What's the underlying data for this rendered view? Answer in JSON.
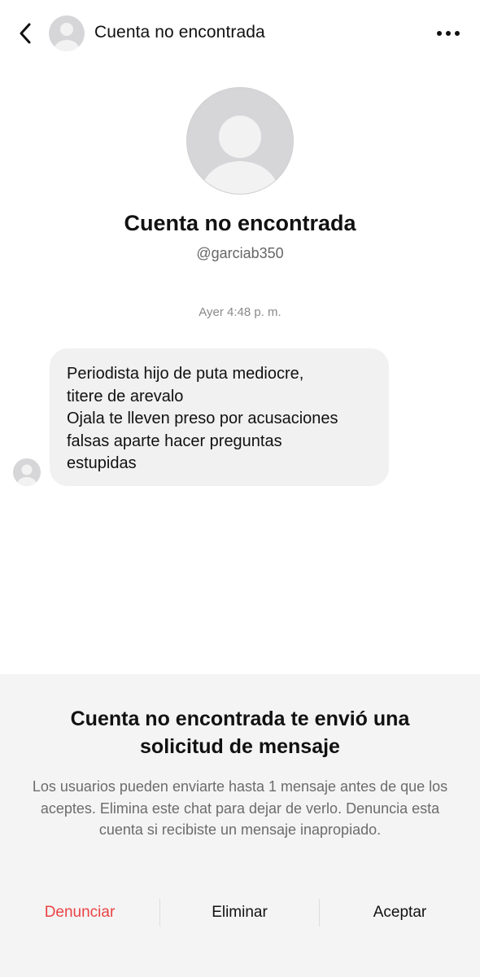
{
  "header": {
    "title": "Cuenta no encontrada",
    "back_icon": "chevron-left-icon",
    "more_icon": "more-horizontal-icon",
    "avatar_icon": "default-avatar-icon"
  },
  "profile": {
    "name": "Cuenta no encontrada",
    "handle": "@garciab350",
    "avatar_icon": "default-avatar-icon"
  },
  "conversation": {
    "timestamp": "Ayer 4:48 p. m.",
    "messages": [
      {
        "text": "Periodista hijo de puta mediocre,\ntitere de arevalo\nOjala te lleven preso por acusaciones\nfalsas aparte hacer preguntas\nestupidas"
      }
    ]
  },
  "request": {
    "title": "Cuenta no encontrada te envió una solicitud de mensaje",
    "description": "Los usuarios pueden enviarte hasta 1 mensaje antes de que los aceptes. Elimina este chat para dejar de verlo. Denuncia esta cuenta si recibiste un mensaje inapropiado.",
    "actions": {
      "report": "Denunciar",
      "delete": "Eliminar",
      "accept": "Aceptar"
    }
  },
  "colors": {
    "report_red": "#ea4344",
    "bubble_bg": "#f1f1f2",
    "panel_bg": "#f4f4f4",
    "avatar_bg": "#d6d6d8"
  }
}
